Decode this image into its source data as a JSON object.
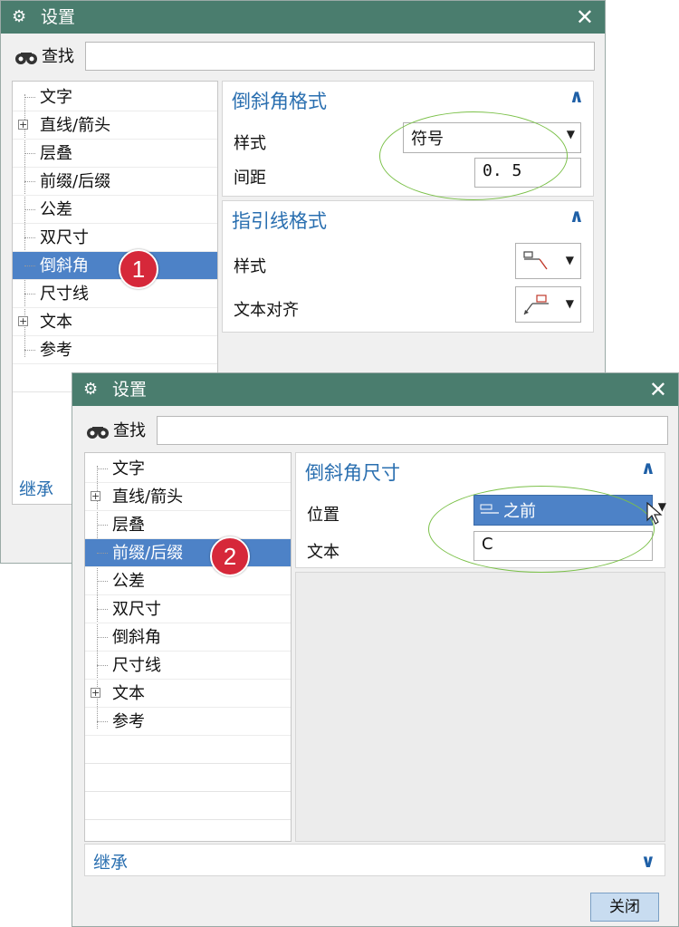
{
  "dialog1": {
    "title": "设置",
    "close": "✕",
    "search_label": "查找",
    "search_value": "",
    "tree": [
      "文字",
      "直线/箭头",
      "层叠",
      "前缀/后缀",
      "公差",
      "双尺寸",
      "倒斜角",
      "尺寸线",
      "文本",
      "参考"
    ],
    "selected_label": "倒斜角",
    "inherit": "继承",
    "callout": "1",
    "panel1": {
      "title": "倒斜角格式",
      "style_label": "样式",
      "style_value": "符号",
      "spacing_label": "间距",
      "spacing_value": "0. 5"
    },
    "panel2": {
      "title": "指引线格式",
      "style_label": "样式",
      "align_label": "文本对齐"
    }
  },
  "dialog2": {
    "title": "设置",
    "close": "✕",
    "search_label": "查找",
    "search_value": "",
    "tree": [
      "文字",
      "直线/箭头",
      "层叠",
      "前缀/后缀",
      "公差",
      "双尺寸",
      "倒斜角",
      "尺寸线",
      "文本",
      "参考"
    ],
    "selected_label": "前缀/后缀",
    "inherit": "继承",
    "callout": "2",
    "panel": {
      "title": "倒斜角尺寸",
      "position_label": "位置",
      "position_value": "之前",
      "text_label": "文本",
      "text_value": "C"
    },
    "close_button": "关闭"
  },
  "colors": {
    "titlebar": "#4a7d6e",
    "accent_blue": "#2a6fb0",
    "selection": "#4d82c7",
    "callout_red": "#d6283a",
    "ellipse_green": "#7cc14a"
  }
}
